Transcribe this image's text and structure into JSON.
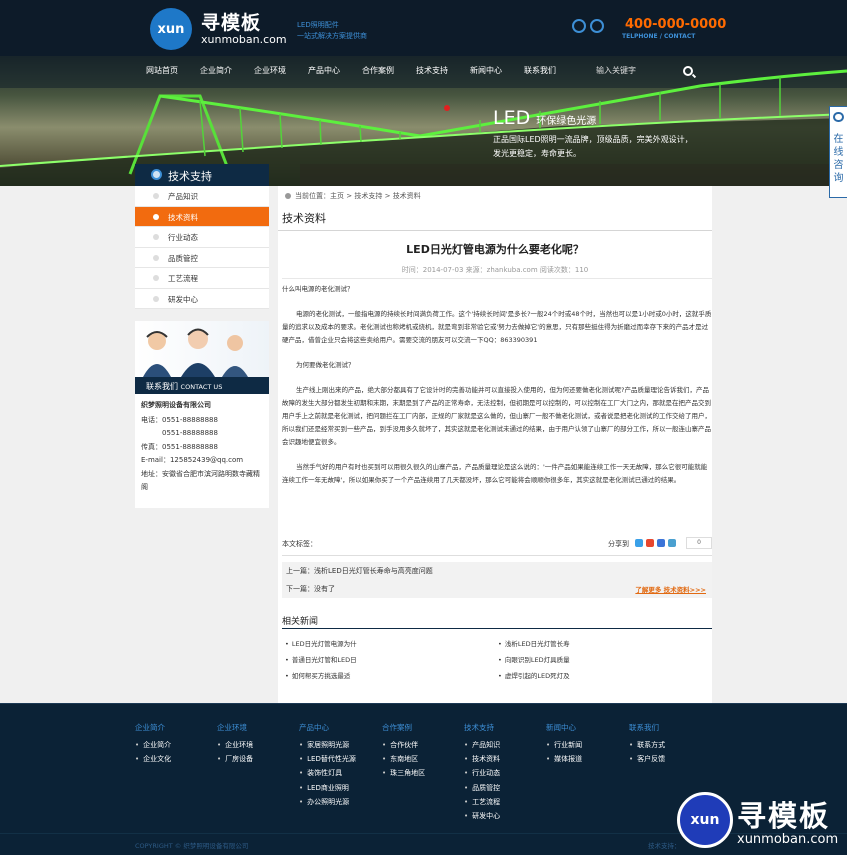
{
  "header": {
    "logo_mark": "xun",
    "logo_cn": "寻模板",
    "logo_en": "xunmoban.com",
    "slogan_1": "LED照明配件",
    "slogan_2": "一站式解决方案提供商",
    "phone": "400-000-0000",
    "phone_sub": "TELPHONE / CONTACT"
  },
  "nav": {
    "items": [
      "网站首页",
      "企业简介",
      "企业环境",
      "产品中心",
      "合作案例",
      "技术支持",
      "新闻中心",
      "联系我们"
    ],
    "search_placeholder": "输入关键字"
  },
  "banner": {
    "title_big": "LED",
    "title_small": "环保绿色光源",
    "line1": "正品国际LED照明一流品牌，顶级品质，完美外观设计，",
    "line2": "发光更稳定，寿命更长。"
  },
  "online_service": "在线咨询",
  "sidebar": {
    "title": "技术支持",
    "items": [
      {
        "label": "产品知识",
        "active": false
      },
      {
        "label": "技术资料",
        "active": true
      },
      {
        "label": "行业动态",
        "active": false
      },
      {
        "label": "品质管控",
        "active": false
      },
      {
        "label": "工艺流程",
        "active": false
      },
      {
        "label": "研发中心",
        "active": false
      }
    ],
    "contact_title": "联系我们",
    "contact_title_en": "CONTACT US",
    "company": "织梦照明设备有限公司",
    "tel_label": "电话：",
    "tel1": "0551-88888888",
    "tel2": "0551-88888888",
    "fax_label": "传真：",
    "fax": "0551-88888888",
    "email_label": "E-mail：",
    "email": "125852439@qq.com",
    "address_label": "地址：",
    "address": "安徽省合肥市滨河路明数寺藏精阁"
  },
  "breadcrumb": {
    "label": "当前位置：",
    "items": [
      "主页",
      "技术支持",
      "技术资料"
    ],
    "sep": ">"
  },
  "page_title": "技术资料",
  "article": {
    "title": "LED日光灯管电源为什么要老化呢？",
    "meta": "时间：2014-07-03    来源：zhankuba.com    阅读次数：110",
    "p1": "什么叫电源的老化测试？",
    "p2": "电源的老化测试，一般指电源的持续长时间满负荷工作。这个'持续长时间'是多长?一般24个时或48个时，当然也可以是1小时或0小时，这就乎质量的追求以及成本的要求。老化测试也称烤机或烧机，就是弯到非常验它或'努力去做掉它'的意思，只有那些挺住得为折磨过而幸存下来的产品才是过硬产品，借曾企业只会将这些卖给用户。需要交流的朋友可以交流一下QQ：863390391",
    "p3": "为何要做老化测试？",
    "p4": "生产线上刚出来的产品，绝大部分都具有了它设计时的完善功能并可以直接投入使用的，但为何还要做老化测试呢?产品质量理论告诉我们，产品故障的发生大部分都发生初期和末期，末期是到了产品的正常寿命，无法控制，但初期是可以控制的，可以控制在工厂大门之内，那就是在把产品交到用户手上之前就是老化测试，把问题拦在工厂内部，正规的厂家就是这么做的，但山寨厂一般不做老化测试，或者说是把老化测试的工作交给了用户，所以我们还是经常买到一些产品，到手没用多久就坏了，其实这就是老化测试未通过的结果，由于用户认领了山寨厂的部分工作，所以一般连山寨产品会识趣地便宜很多。",
    "p5": "当然手气好的用户有时也买到可以用很久很久的山寨产品，产品质量理论是这么说的：'一件产品如果能连续工作一天无故障，那么它很可能就能连续工作一年无故障'，所以如果你买了一个产品连续用了几天都没坏，那么它可能将会顺顺你很多年，其实这就是老化测试已通过的结果。",
    "tags_label": "本文标签：",
    "share_label": "分享到",
    "share_count": "0",
    "prev": "上一篇：浅析LED日光灯管长寿命与高亮度问题",
    "next": "下一篇：没有了",
    "more": "了解更多 技术资料>>>"
  },
  "related": {
    "title": "相关新闻",
    "items": [
      "LED日光灯管电源为什",
      "浅析LED日光灯管长寿",
      "普通日光灯管和LED日",
      "向眼识别LED灯具质量",
      "如何帮买方挑选最适",
      "虚焊引起的LED死灯及"
    ]
  },
  "footer": {
    "columns": [
      {
        "title": "企业简介",
        "items": [
          "企业简介",
          "企业文化"
        ]
      },
      {
        "title": "企业环境",
        "items": [
          "企业环境",
          "厂房设备"
        ]
      },
      {
        "title": "产品中心",
        "items": [
          "家居照明光源",
          "LED替代性光源",
          "装饰性灯具",
          "LED商业照明",
          "办公照明光源"
        ]
      },
      {
        "title": "合作案例",
        "items": [
          "合作伙伴",
          "东南地区",
          "珠三角地区"
        ]
      },
      {
        "title": "技术支持",
        "items": [
          "产品知识",
          "技术资料",
          "行业动态",
          "品质管控",
          "工艺流程",
          "研发中心"
        ]
      },
      {
        "title": "新闻中心",
        "items": [
          "行业新闻",
          "媒体报道"
        ]
      },
      {
        "title": "联系我们",
        "items": [
          "联系方式",
          "客户反馈"
        ]
      }
    ],
    "copyright": "COPYRIGHT © 织梦照明设备有限公司",
    "copyright_right": "技术支持：",
    "watermark_mark": "xun",
    "watermark_cn": "寻模板",
    "watermark_en": "xunmoban.com"
  }
}
